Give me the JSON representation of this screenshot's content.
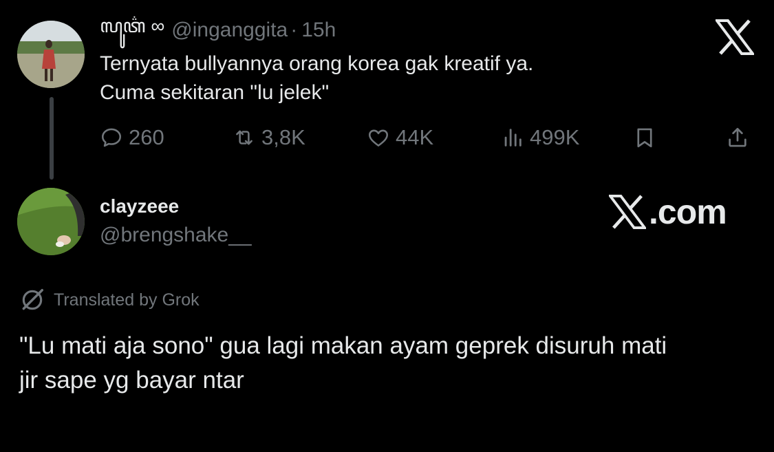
{
  "tweet1": {
    "display_name": "ꦭꦸꦠ꦳ ∞",
    "handle": "@inganggita",
    "separator": "·",
    "time": "15h",
    "text_lines": [
      "Ternyata bullyannya orang korea gak kreatif ya.",
      "Cuma sekitaran \"lu jelek\""
    ],
    "actions": {
      "replies": "260",
      "reposts": "3,8K",
      "likes": "44K",
      "views": "499K"
    }
  },
  "tweet2": {
    "display_name": "clayzeee",
    "handle": "@brengshake__",
    "translated_label": "Translated by Grok",
    "text_lines": [
      "\"Lu mati aja sono\" gua lagi makan ayam geprek disuruh mati",
      "jir sape yg bayar ntar"
    ]
  },
  "watermark": {
    "domain_suffix": ".com"
  },
  "icons": {
    "brand": "x-logo-icon",
    "reply": "reply-icon",
    "repost": "repost-icon",
    "like": "heart-icon",
    "views": "views-icon",
    "bookmark": "bookmark-icon",
    "share": "share-icon",
    "grok": "grok-icon"
  },
  "colors": {
    "background": "#000000",
    "text_primary": "#e7e9ea",
    "text_secondary": "#71767b"
  }
}
